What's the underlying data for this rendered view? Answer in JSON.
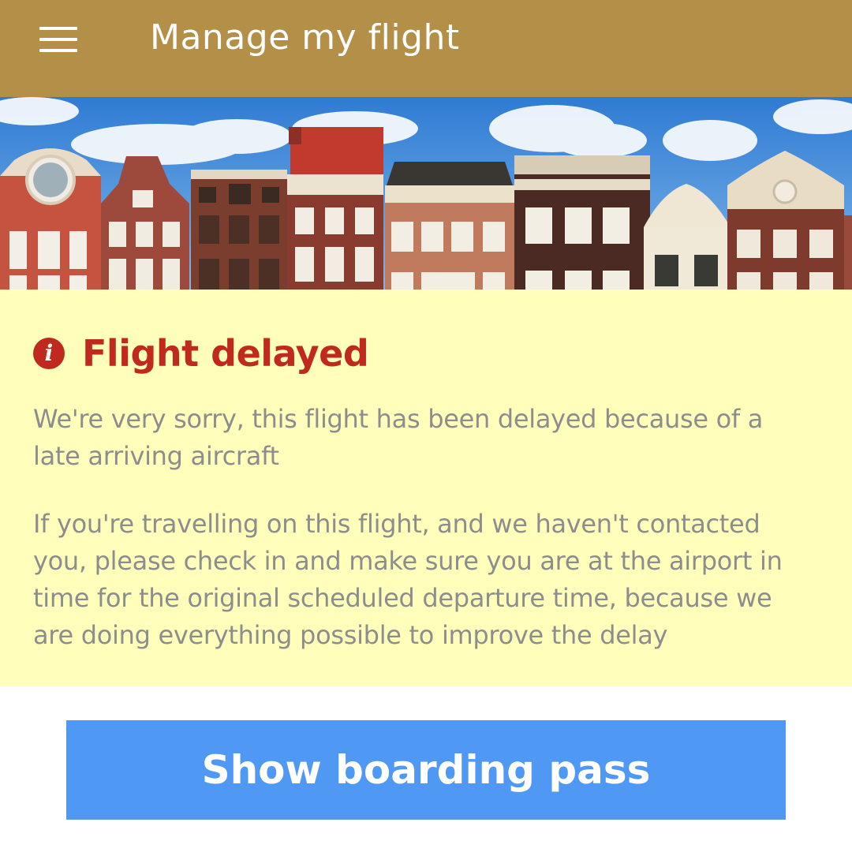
{
  "header": {
    "menu_icon": "hamburger-menu-icon",
    "title": "Manage my flight",
    "background": "#b38f48"
  },
  "hero": {
    "description_icon": "amsterdam-canal-houses-banner"
  },
  "alert": {
    "icon": "info-icon",
    "icon_glyph": "i",
    "title": "Flight delayed",
    "message_1": "We're very sorry, this flight has been delayed because of a late arriving aircraft",
    "message_2": "If you're travelling on this flight, and we haven't  contacted you, please check in and make sure you are at the airport in time for the original scheduled departure time, because we are doing everything possible to improve the delay",
    "background": "#ffffbb",
    "title_color": "#c0291d"
  },
  "actions": {
    "boarding_pass_label": "Show boarding pass",
    "button_color": "#4f98f4"
  }
}
